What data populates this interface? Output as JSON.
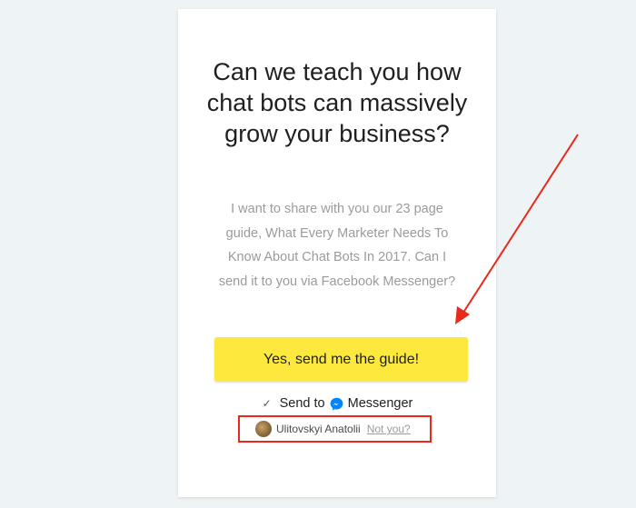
{
  "card": {
    "headline": "Can we teach you how chat bots can massively grow your business?",
    "description": "I want to share with you our 23 page guide, What Every Marketer Needs To Know About Chat Bots In 2017. Can I send it to you via Facebook Messenger?",
    "cta_label": "Yes, send me the guide!",
    "send_to": {
      "checked": true,
      "prefix": "Send to",
      "icon": "messenger-icon",
      "service": "Messenger"
    },
    "user": {
      "name": "Ulitovskyi Anatolii",
      "not_you": "Not you?"
    }
  },
  "colors": {
    "background": "#eef4f5",
    "card": "#ffffff",
    "button": "#fde93d",
    "annotation": "#e8291c",
    "messenger": "#0084ff"
  }
}
